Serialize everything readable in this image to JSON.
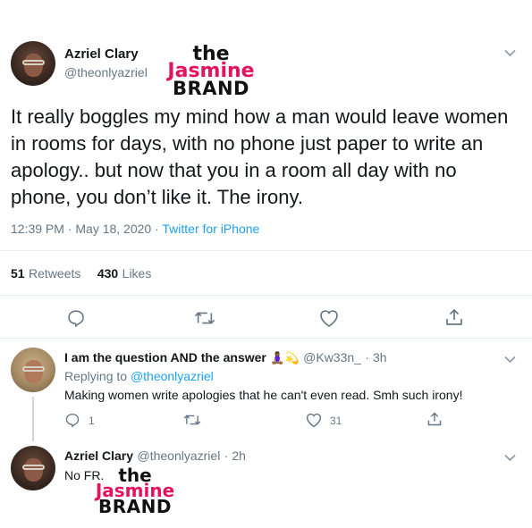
{
  "main_tweet": {
    "name": "Azriel Clary",
    "handle": "@theonlyazriel",
    "text": "It really boggles my mind how a man would leave women in rooms for days, with no phone just paper to write an apology.. but now that you in a room all day with no phone, you don’t like it. The irony.",
    "timestamp": "12:39 PM · May 18, 2020 ·",
    "source": "Twitter for iPhone",
    "retweets_count": "51",
    "retweets_label": "Retweets",
    "likes_count": "430",
    "likes_label": "Likes"
  },
  "reply": {
    "name": "I am the question AND the answer",
    "emojis": "🧘🏾‍♀️💫",
    "handle": "@Kw33n_",
    "time": "· 3h",
    "replying_prefix": "Replying to",
    "replying_to": "@theonlyazriel",
    "text": "Making women write apologies that he can't even read. Smh such irony!",
    "reply_count": "1",
    "like_count": "31"
  },
  "reply2": {
    "name": "Azriel Clary",
    "handle": "@theonlyazriel",
    "time": "· 2h",
    "text": "No FR."
  },
  "watermark": {
    "line1": "the",
    "line2": "Jasmine",
    "line3": "BRAND"
  },
  "icons": {
    "reply": "reply-icon",
    "retweet": "retweet-icon",
    "like": "heart-icon",
    "share": "share-icon",
    "more": "chevron-down-icon"
  },
  "colors": {
    "text": "#14171a",
    "muted": "#657786",
    "link": "#1da1f2",
    "watermark_pink": "#e4135f"
  }
}
